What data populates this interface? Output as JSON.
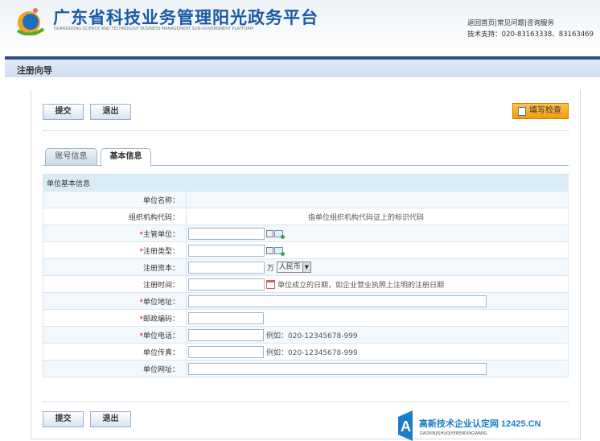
{
  "header": {
    "title": "广东省科技业务管理阳光政务平台",
    "subtitle": "GUANGDONG SCIENCE AND TECHNOLOGY BUSINESS MANAGEMENT SUN-GOVERNMENT PLATFORM",
    "links": [
      "返回首页",
      "常见问题",
      "咨询服务"
    ],
    "support": "技术支持：020-83163338、83163469"
  },
  "breadcrumb": "注册向导",
  "toolbar": {
    "submit": "提交",
    "exit": "退出",
    "check": "填写检查"
  },
  "tabs": [
    {
      "label": "账号信息",
      "active": false
    },
    {
      "label": "基本信息",
      "active": true
    }
  ],
  "section_title": "单位基本信息",
  "fields": {
    "name": {
      "label": "单位名称：",
      "value": ""
    },
    "org_code": {
      "label": "组织机构代码：",
      "hint": "指单位组织机构代码证上的标识代码"
    },
    "supervisor": {
      "label": "主管单位：",
      "required": "*",
      "value": ""
    },
    "reg_type": {
      "label": "注册类型：",
      "required": "*",
      "value": ""
    },
    "capital": {
      "label": "注册资本：",
      "value": "",
      "unit": "万",
      "currency": "人民币"
    },
    "reg_date": {
      "label": "注册时间：",
      "value": "",
      "hint": "单位成立的日期，如企业营业执照上注明的注册日期"
    },
    "address": {
      "label": "单位地址：",
      "required": "*",
      "value": ""
    },
    "postcode": {
      "label": "邮政编码：",
      "required": "*",
      "value": ""
    },
    "phone": {
      "label": "单位电话：",
      "required": "*",
      "value": "",
      "hint": "例如：020-12345678-999"
    },
    "fax": {
      "label": "单位传真：",
      "value": "",
      "hint": "例如：020-12345678-999"
    },
    "website": {
      "label": "单位网址：",
      "value": ""
    }
  },
  "watermark": {
    "text": "高新技术企业认定网 12425.CN",
    "pinyin": "GAOXINJISHUQIYERENDINGWANG"
  }
}
